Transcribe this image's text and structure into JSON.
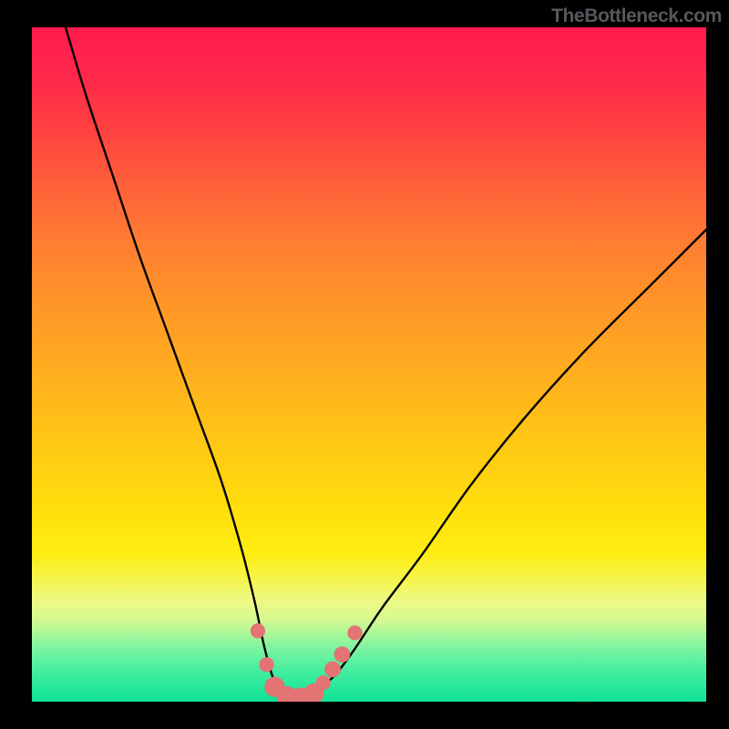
{
  "watermark": "TheBottleneck.com",
  "colors": {
    "gradient_top": "#ff1a4d",
    "gradient_bottom": "#0fe296",
    "curve": "#000000",
    "marker": "#e47373",
    "frame": "#000000"
  },
  "chart_data": {
    "type": "line",
    "title": "",
    "xlabel": "",
    "ylabel": "",
    "xlim": [
      0,
      100
    ],
    "ylim": [
      0,
      100
    ],
    "series": [
      {
        "name": "curve",
        "x": [
          5,
          8,
          12,
          16,
          20,
          24,
          28,
          31,
          33,
          34.5,
          36,
          38,
          40,
          42,
          45,
          48,
          52,
          58,
          65,
          73,
          82,
          92,
          100
        ],
        "y": [
          100,
          90,
          78,
          66,
          55,
          44,
          33,
          23,
          15,
          8,
          3,
          0.5,
          0.5,
          1.5,
          4,
          8,
          14,
          22,
          32,
          42,
          52,
          62,
          70
        ]
      }
    ],
    "markers": [
      {
        "x": 33.5,
        "y": 10.5,
        "r": 1.1
      },
      {
        "x": 34.8,
        "y": 5.5,
        "r": 1.1
      },
      {
        "x": 36.0,
        "y": 2.2,
        "r": 1.5
      },
      {
        "x": 37.8,
        "y": 0.8,
        "r": 1.5
      },
      {
        "x": 39.8,
        "y": 0.6,
        "r": 1.5
      },
      {
        "x": 41.8,
        "y": 1.2,
        "r": 1.5
      },
      {
        "x": 43.2,
        "y": 2.8,
        "r": 1.1
      },
      {
        "x": 44.6,
        "y": 4.8,
        "r": 1.2
      },
      {
        "x": 46.0,
        "y": 7.0,
        "r": 1.2
      },
      {
        "x": 47.9,
        "y": 10.2,
        "r": 1.1
      }
    ]
  }
}
